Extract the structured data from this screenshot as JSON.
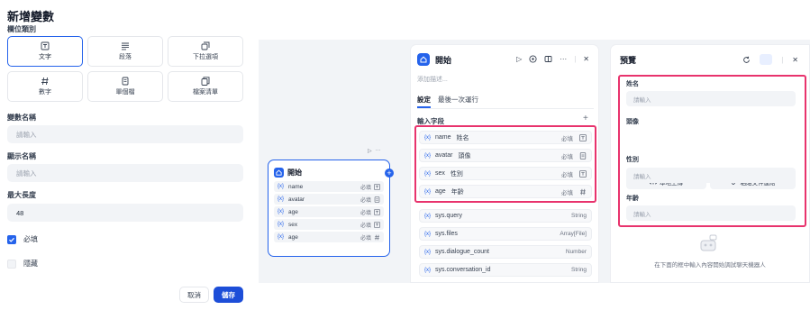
{
  "form": {
    "title": "新增變數",
    "type_label": "欄位類別",
    "types": [
      {
        "label": "文字",
        "icon": "text-input-icon",
        "active": true
      },
      {
        "label": "段落",
        "icon": "paragraph-icon",
        "active": false
      },
      {
        "label": "下拉選項",
        "icon": "select-icon",
        "active": false
      },
      {
        "label": "數字",
        "icon": "number-icon",
        "active": false
      },
      {
        "label": "單個檔",
        "icon": "single-file-icon",
        "active": false
      },
      {
        "label": "檔案清單",
        "icon": "file-list-icon",
        "active": false
      }
    ],
    "var_name_label": "變數名稱",
    "var_name_placeholder": "請輸入",
    "display_name_label": "顯示名稱",
    "display_name_placeholder": "請輸入",
    "max_length_label": "最大長度",
    "max_length_value": "48",
    "required_label": "必填",
    "required_checked": true,
    "hidden_label": "隱藏",
    "hidden_checked": false,
    "cancel_label": "取消",
    "save_label": "儲存"
  },
  "node": {
    "title": "開始",
    "rows": [
      {
        "name": "name",
        "required": "必填"
      },
      {
        "name": "avatar",
        "required": "必填"
      },
      {
        "name": "age",
        "required": "必填"
      },
      {
        "name": "sex",
        "required": "必填"
      },
      {
        "name": "age",
        "required": "必填"
      }
    ]
  },
  "settings": {
    "title": "開始",
    "description_placeholder": "添加描述...",
    "tabs": [
      "設定",
      "最後一次運行"
    ],
    "input_section_label": "輸入字段",
    "inputs": [
      {
        "var": "name",
        "label": "姓名",
        "required": "必填",
        "type_icon": "text-icon"
      },
      {
        "var": "avatar",
        "label": "頭像",
        "required": "必填",
        "type_icon": "file-icon"
      },
      {
        "var": "sex",
        "label": "性別",
        "required": "必填",
        "type_icon": "text-icon"
      },
      {
        "var": "age",
        "label": "年齡",
        "required": "必填",
        "type_icon": "number-icon"
      }
    ],
    "system_vars": [
      {
        "var": "sys.query",
        "type": "String"
      },
      {
        "var": "sys.files",
        "type": "Array[File]"
      },
      {
        "var": "sys.dialogue_count",
        "type": "Number"
      },
      {
        "var": "sys.conversation_id",
        "type": "String"
      }
    ]
  },
  "preview": {
    "title": "預覽",
    "fields": [
      {
        "label": "姓名",
        "placeholder": "請輸入"
      },
      {
        "label": "頭像"
      },
      {
        "label": "性別",
        "placeholder": "請輸入"
      },
      {
        "label": "年齡",
        "placeholder": "請輸入"
      }
    ],
    "upload_local": "本地上傳",
    "paste_link": "粘貼文件連結",
    "hint": "在下面的框中輸入內容開始調試聊天機器人"
  },
  "colors": {
    "accent": "#2563eb",
    "highlight": "#e8336d"
  }
}
